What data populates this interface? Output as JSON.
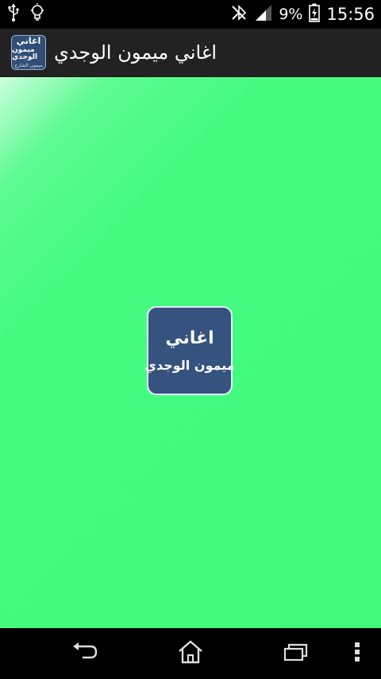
{
  "status_bar": {
    "battery_percent": "9%",
    "time": "15:56",
    "icons": [
      "usb-icon",
      "bulb-icon",
      "mute-icon",
      "signal-icon",
      "battery-charging-icon"
    ]
  },
  "action_bar": {
    "title": "اغاني ميمون الوجدي",
    "icon": {
      "line1": "اغاني",
      "line2": "ميمون الوجدي",
      "line3": "ميمون الشارخ"
    }
  },
  "content": {
    "background_color": "#41fa7d",
    "logo": {
      "line1": "اغاني",
      "line2": "ميمون الوجدي",
      "background_color": "#35537e"
    }
  },
  "nav_bar": {
    "buttons": [
      "back-icon",
      "home-icon",
      "recents-icon",
      "menu-icon"
    ]
  }
}
